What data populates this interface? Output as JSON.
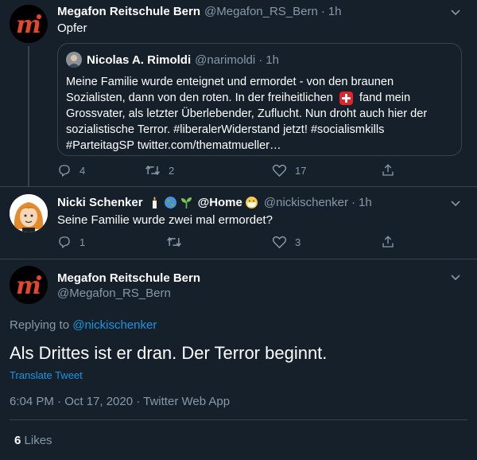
{
  "tweet1": {
    "name": "Megafon Reitschule Bern",
    "handle": "@Megafon_RS_Bern",
    "separator": "·",
    "time": "1h",
    "text": "Opfer",
    "quote": {
      "name": "Nicolas A. Rimoldi",
      "handle": "@narimoldi",
      "separator": "·",
      "time": "1h",
      "line1": "Meine Familie wurde enteignet und ermordet - von den braunen",
      "line2": "Sozialisten, dann von den roten. In der freiheitlichen",
      "line2b": "fand mein",
      "line3": "Grossvater, als letzter Überlebender, Zuflucht. Nun droht auch hier der",
      "line4": "sozialistische Terror. #liberalerWiderstand jetzt! #socialismkills",
      "line5": "#ParteitagSP twitter.com/thematmueller…"
    },
    "replies": "4",
    "retweets": "2",
    "likes": "17"
  },
  "tweet2": {
    "name": "Nicki Schenker",
    "name_suffix": "@Home",
    "handle": "@nickischenker",
    "separator": "·",
    "time": "1h",
    "text": "Seine Familie wurde zwei mal ermordet?",
    "replies": "1",
    "retweets": "",
    "likes": "3"
  },
  "main_tweet": {
    "name": "Megafon Reitschule Bern",
    "handle": "@Megafon_RS_Bern",
    "replying_prefix": "Replying to",
    "replying_to": "@nickischenker",
    "text": "Als Drittes ist er dran. Der Terror beginnt.",
    "translate": "Translate Tweet",
    "meta": "6:04 PM · Oct 17, 2020 · Twitter Web App",
    "likes_count": "6",
    "likes_label": "Likes"
  },
  "icons": {
    "chevron": "chevron-down-icon",
    "reply": "reply-icon",
    "retweet": "retweet-icon",
    "like": "heart-icon",
    "share": "share-icon"
  },
  "colors": {
    "background": "#15202b",
    "border": "#38444d",
    "muted": "#8899a6",
    "link": "#1b95e0",
    "megafon_m": "#e8462a",
    "swiss_red": "#e0242c"
  }
}
